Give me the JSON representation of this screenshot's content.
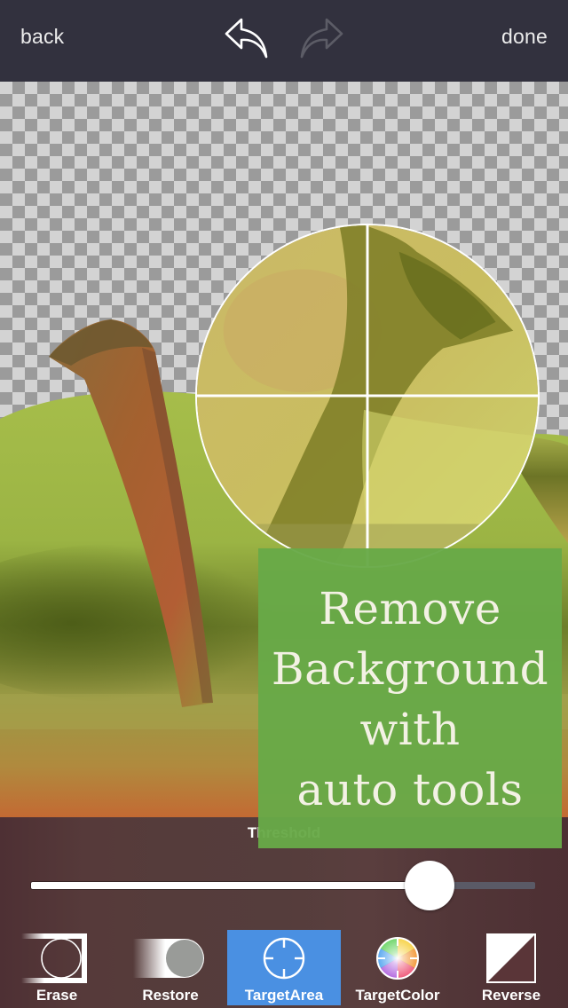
{
  "topbar": {
    "back_label": "back",
    "done_label": "done",
    "undo_icon": "undo-arrow-icon",
    "redo_icon": "redo-arrow-icon",
    "undo_enabled": true,
    "redo_enabled": false
  },
  "canvas": {
    "background": "transparent-checkerboard",
    "magnifier_icon": "crosshair-magnifier"
  },
  "promo": {
    "lines": [
      "Remove",
      "Background",
      "with",
      "auto tools"
    ],
    "background_color": "#68aa48"
  },
  "bottom": {
    "threshold_label": "Threshold",
    "threshold_value": 0.79,
    "tools": [
      {
        "label": "Erase",
        "icon": "erase-icon",
        "active": false
      },
      {
        "label": "Restore",
        "icon": "restore-icon",
        "active": false
      },
      {
        "label": "TargetArea",
        "icon": "target-area-crosshair-icon",
        "active": true
      },
      {
        "label": "TargetColor",
        "icon": "target-color-wheel-icon",
        "active": false
      },
      {
        "label": "Reverse",
        "icon": "reverse-icon",
        "active": false
      }
    ],
    "active_color": "#4a90e2"
  }
}
